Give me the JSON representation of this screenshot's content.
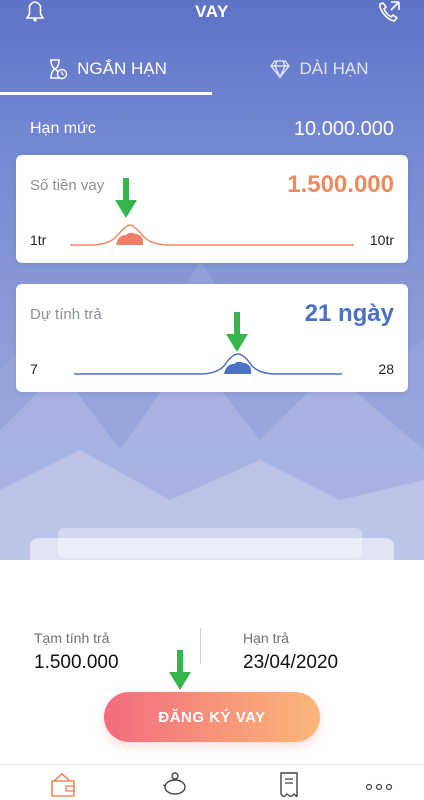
{
  "header": {
    "title": "VAY"
  },
  "tabs": [
    {
      "label": "NGẮN HẠN",
      "active": true,
      "icon": "hourglass-icon"
    },
    {
      "label": "DÀI HẠN",
      "active": false,
      "icon": "diamond-icon"
    }
  ],
  "limit": {
    "label": "Hạn mức",
    "value": "10.000.000"
  },
  "amount_card": {
    "label": "Số tiền vay",
    "value": "1.500.000",
    "min_label": "1tr",
    "max_label": "10tr",
    "position_fraction": 0.06
  },
  "term_card": {
    "label": "Dự tính trả",
    "value": "21 ngày",
    "min_label": "7",
    "max_label": "28",
    "position_fraction": 0.62
  },
  "summary": {
    "tentative_label": "Tạm tính trả",
    "tentative_value": "1.500.000",
    "due_label": "Hạn trả",
    "due_value": "23/04/2020"
  },
  "cta": {
    "label": "ĐĂNG KÝ VAY"
  },
  "colors": {
    "hero_top": "#5e72c6",
    "amount_accent": "#f08a5e",
    "term_accent": "#4b70c4",
    "cta_start": "#f36b7f",
    "cta_end": "#fbb77a",
    "arrow_green": "#35b54a"
  },
  "bottom_nav": [
    {
      "icon": "wallet-icon",
      "active": true
    },
    {
      "icon": "piggy-bank-icon",
      "active": false
    },
    {
      "icon": "receipt-icon",
      "active": false
    },
    {
      "icon": "more-icon",
      "active": false
    }
  ]
}
